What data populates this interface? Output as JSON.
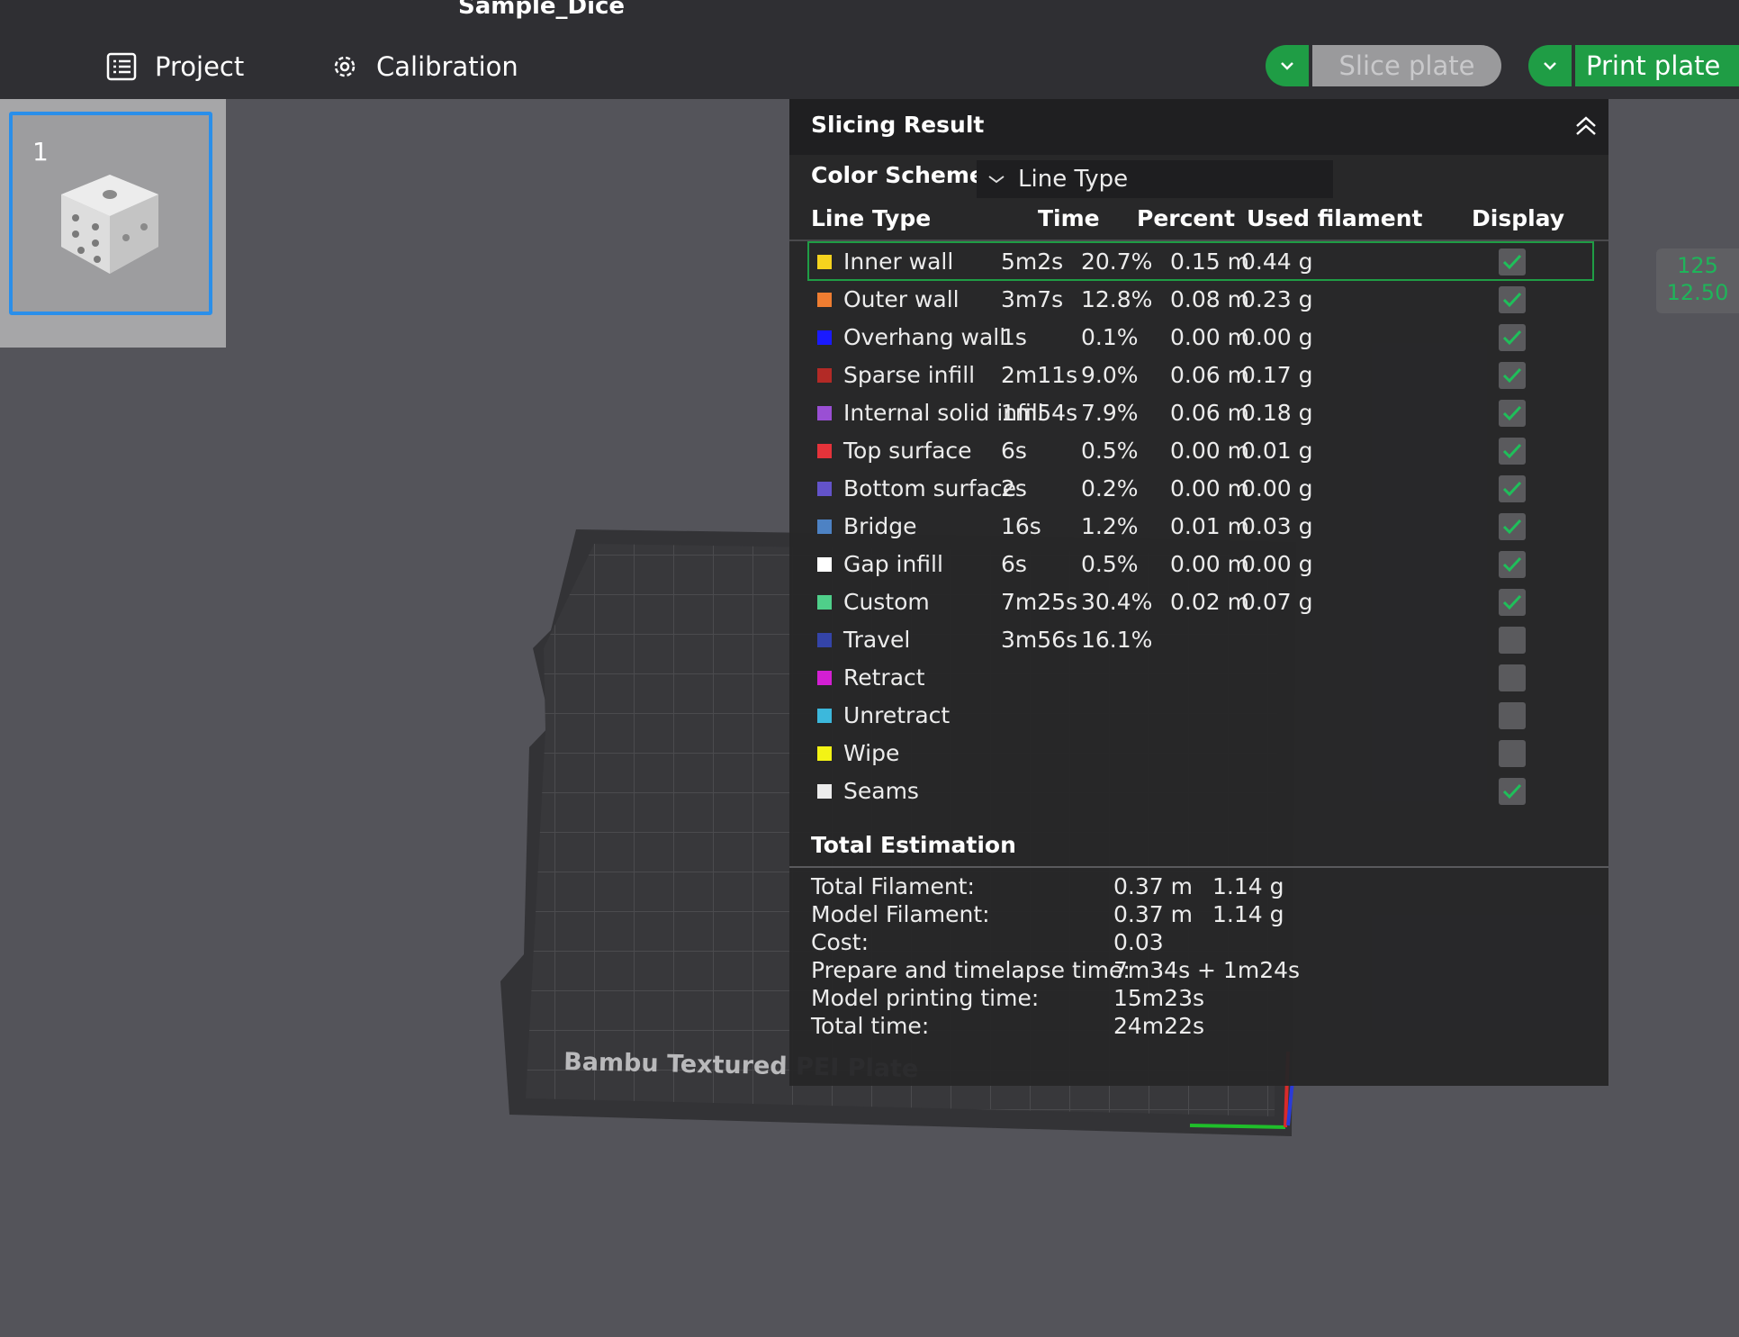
{
  "app": {
    "title": "Sample_Dice"
  },
  "nav": {
    "project": "Project",
    "calibration": "Calibration"
  },
  "buttons": {
    "slice": "Slice plate",
    "print": "Print plate"
  },
  "plate": {
    "number": "1"
  },
  "layer_readout": {
    "top": "125",
    "bottom": "12.50"
  },
  "bed_label": "Bambu Textured PEI Plate",
  "panel": {
    "title": "Slicing Result",
    "color_scheme_label": "Color Scheme",
    "color_scheme_value": "Line Type",
    "columns": {
      "type": "Line Type",
      "time": "Time",
      "percent": "Percent",
      "used": "Used filament",
      "display": "Display"
    },
    "rows": [
      {
        "name": "Inner wall",
        "time": "5m2s",
        "percent": "20.7%",
        "length": "0.15 m",
        "weight": "0.44 g",
        "color": "#f5d31e",
        "display": true,
        "selected": true
      },
      {
        "name": "Outer wall",
        "time": "3m7s",
        "percent": "12.8%",
        "length": "0.08 m",
        "weight": "0.23 g",
        "color": "#ef7d31",
        "display": true
      },
      {
        "name": "Overhang wall",
        "time": "1s",
        "percent": "0.1%",
        "length": "0.00 m",
        "weight": "0.00 g",
        "color": "#1a1aff",
        "display": true
      },
      {
        "name": "Sparse infill",
        "time": "2m11s",
        "percent": "9.0%",
        "length": "0.06 m",
        "weight": "0.17 g",
        "color": "#b32a26",
        "display": true
      },
      {
        "name": "Internal solid infill",
        "time": "1m54s",
        "percent": "7.9%",
        "length": "0.06 m",
        "weight": "0.18 g",
        "color": "#9a4fd4",
        "display": true
      },
      {
        "name": "Top surface",
        "time": "6s",
        "percent": "0.5%",
        "length": "0.00 m",
        "weight": "0.01 g",
        "color": "#e5333a",
        "display": true
      },
      {
        "name": "Bottom surface",
        "time": "2s",
        "percent": "0.2%",
        "length": "0.00 m",
        "weight": "0.00 g",
        "color": "#6353c9",
        "display": true
      },
      {
        "name": "Bridge",
        "time": "16s",
        "percent": "1.2%",
        "length": "0.01 m",
        "weight": "0.03 g",
        "color": "#4d82c4",
        "display": true
      },
      {
        "name": "Gap infill",
        "time": "6s",
        "percent": "0.5%",
        "length": "0.00 m",
        "weight": "0.00 g",
        "color": "#ffffff",
        "display": true
      },
      {
        "name": "Custom",
        "time": "7m25s",
        "percent": "30.4%",
        "length": "0.02 m",
        "weight": "0.07 g",
        "color": "#4fcf8a",
        "display": true
      },
      {
        "name": "Travel",
        "time": "3m56s",
        "percent": "16.1%",
        "length": "",
        "weight": "",
        "color": "#3444a8",
        "display": false
      },
      {
        "name": "Retract",
        "time": "",
        "percent": "",
        "length": "",
        "weight": "",
        "color": "#d31fd3",
        "display": false
      },
      {
        "name": "Unretract",
        "time": "",
        "percent": "",
        "length": "",
        "weight": "",
        "color": "#3cb8dc",
        "display": false
      },
      {
        "name": "Wipe",
        "time": "",
        "percent": "",
        "length": "",
        "weight": "",
        "color": "#f3f315",
        "display": false
      },
      {
        "name": "Seams",
        "time": "",
        "percent": "",
        "length": "",
        "weight": "",
        "color": "#ececec",
        "display": true
      }
    ],
    "total_title": "Total Estimation",
    "estimation": [
      {
        "label": "Total Filament:",
        "v1": "0.37 m",
        "v2": "1.14 g"
      },
      {
        "label": "Model Filament:",
        "v1": "0.37 m",
        "v2": "1.14 g"
      },
      {
        "label": "Cost:",
        "v1": "0.03",
        "v2": ""
      },
      {
        "label": "Prepare and timelapse time:",
        "v1": "7m34s + 1m24s",
        "v2": ""
      },
      {
        "label": "Model printing time:",
        "v1": "15m23s",
        "v2": ""
      },
      {
        "label": "Total time:",
        "v1": "24m22s",
        "v2": ""
      }
    ]
  },
  "colors": {
    "accent_green": "#1f9d45",
    "selection_blue": "#2a8fea"
  }
}
